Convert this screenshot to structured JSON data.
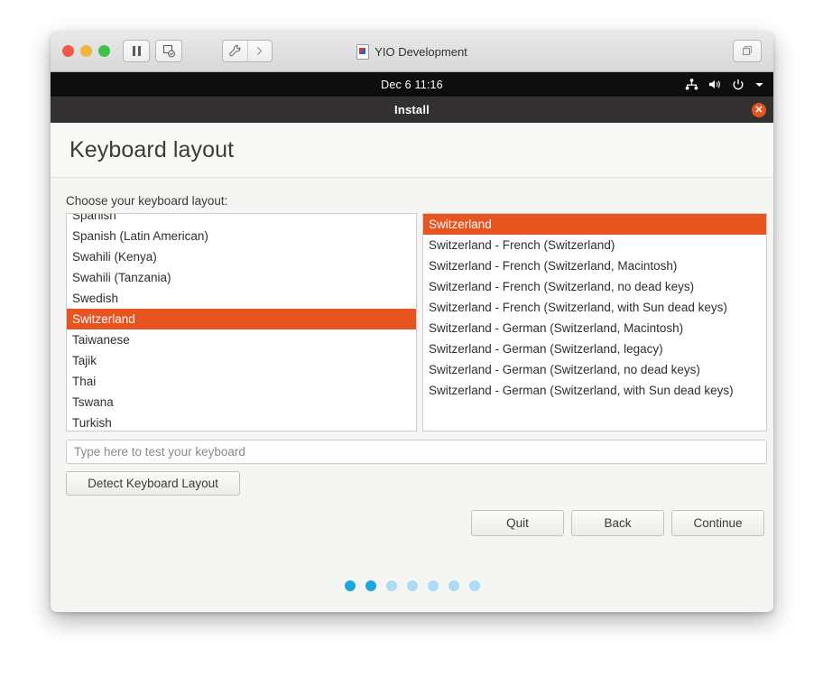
{
  "vm": {
    "title": "YIO Development",
    "title_icon": "vm-file-icon",
    "toolbar": {
      "close_label": "",
      "minimize_label": "",
      "maximize_label": "",
      "pause_icon": "pause-icon",
      "snapshot_icon": "snapshot-icon",
      "tools_icon": "wrench-icon",
      "tools_more_icon": "chevron-right-icon",
      "fullscreen_icon": "fullscreen-windows-icon"
    }
  },
  "ubuntu_panel": {
    "clock": "Dec 6  11:16",
    "indicators": [
      {
        "name": "network-icon"
      },
      {
        "name": "volume-icon"
      },
      {
        "name": "power-icon"
      },
      {
        "name": "chevron-down-icon"
      }
    ]
  },
  "installer": {
    "window_title": "Install",
    "close_icon": "✕",
    "page_title": "Keyboard layout",
    "choose_label": "Choose your keyboard layout:",
    "layouts": [
      {
        "label": "Spanish",
        "selected": false,
        "clipped": "top"
      },
      {
        "label": "Spanish (Latin American)",
        "selected": false
      },
      {
        "label": "Swahili (Kenya)",
        "selected": false
      },
      {
        "label": "Swahili (Tanzania)",
        "selected": false
      },
      {
        "label": "Swedish",
        "selected": false
      },
      {
        "label": "Switzerland",
        "selected": true
      },
      {
        "label": "Taiwanese",
        "selected": false
      },
      {
        "label": "Tajik",
        "selected": false
      },
      {
        "label": "Thai",
        "selected": false
      },
      {
        "label": "Tswana",
        "selected": false
      },
      {
        "label": "Turkish",
        "selected": false,
        "clipped": "bottom"
      }
    ],
    "variants": [
      {
        "label": "Switzerland",
        "selected": true
      },
      {
        "label": "Switzerland - French (Switzerland)",
        "selected": false
      },
      {
        "label": "Switzerland - French (Switzerland, Macintosh)",
        "selected": false
      },
      {
        "label": "Switzerland - French (Switzerland, no dead keys)",
        "selected": false
      },
      {
        "label": "Switzerland - French (Switzerland, with Sun dead keys)",
        "selected": false
      },
      {
        "label": "Switzerland - German (Switzerland, Macintosh)",
        "selected": false
      },
      {
        "label": "Switzerland - German (Switzerland, legacy)",
        "selected": false
      },
      {
        "label": "Switzerland - German (Switzerland, no dead keys)",
        "selected": false
      },
      {
        "label": "Switzerland - German (Switzerland, with Sun dead keys)",
        "selected": false
      }
    ],
    "test_input": {
      "value": "",
      "placeholder": "Type here to test your keyboard"
    },
    "detect_button": "Detect Keyboard Layout",
    "nav": {
      "quit": "Quit",
      "back": "Back",
      "continue": "Continue"
    },
    "progress": {
      "total": 7,
      "completed": 2,
      "dots": [
        true,
        true,
        false,
        false,
        false,
        false,
        false
      ]
    }
  },
  "colors": {
    "accent_orange": "#e8541f",
    "panel_black": "#0d0d0d",
    "titlebar_dark": "#333131",
    "dot_active": "#1ba7e0",
    "dot_inactive": "#a9ddf3"
  }
}
